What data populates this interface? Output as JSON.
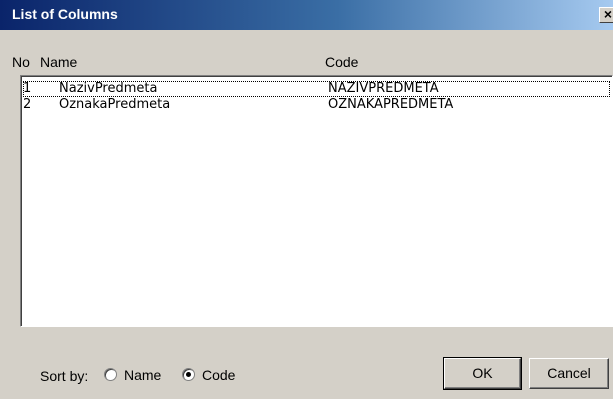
{
  "window": {
    "title": "List of Columns",
    "close_glyph": "×"
  },
  "columns": {
    "no": "No",
    "name": "Name",
    "code": "Code"
  },
  "rows": [
    {
      "no": "1",
      "name": "NazivPredmeta",
      "code": "NAZIVPREDMETA",
      "selected": true
    },
    {
      "no": "2",
      "name": "OznakaPredmeta",
      "code": "OZNAKAPREDMETA",
      "selected": false
    }
  ],
  "sort": {
    "label": "Sort by:",
    "options": [
      {
        "label": "Name",
        "selected": false
      },
      {
        "label": "Code",
        "selected": true
      }
    ]
  },
  "buttons": {
    "ok": "OK",
    "cancel": "Cancel"
  }
}
